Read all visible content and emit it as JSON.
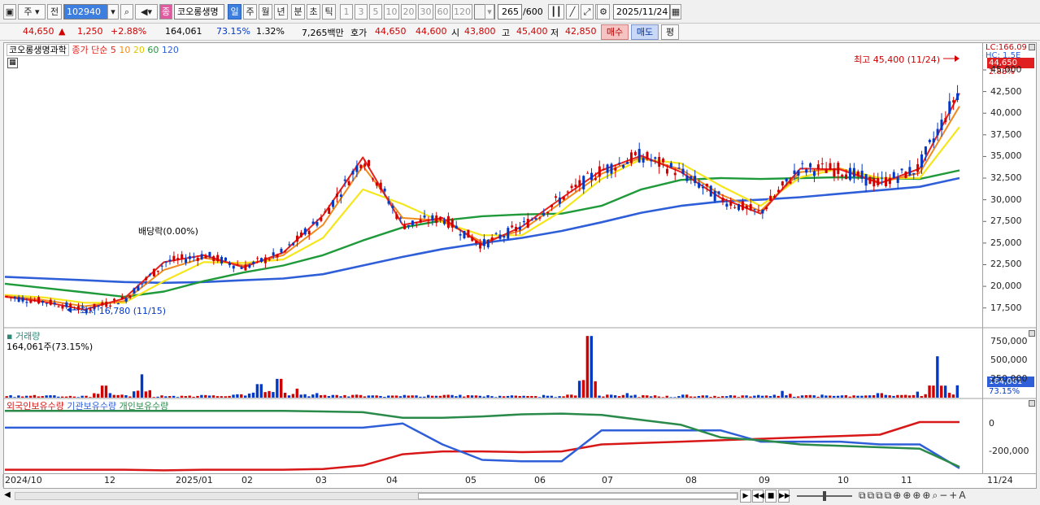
{
  "toolbar": {
    "market": "주",
    "market2": "전",
    "code": "102940",
    "stock_name": "코오롱생명",
    "badge": "종",
    "periods": [
      "일",
      "주",
      "월",
      "년",
      "분",
      "초",
      "틱"
    ],
    "period_selected": "일",
    "intervals": [
      "1",
      "3",
      "5",
      "10",
      "20",
      "30",
      "60",
      "120"
    ],
    "count": "265",
    "count_total": "/600",
    "date": "2025/11/24"
  },
  "quote": {
    "price": "44,650",
    "arrow": "▲",
    "change": "1,250",
    "change_pct": "+2.88%",
    "volume": "164,061",
    "vol_ratio": "73.15%",
    "turnover": "1.32%",
    "amount": "7,265백만",
    "ask_label": "호가",
    "ask": "44,650",
    "bid": "44,600",
    "open_label": "시",
    "open": "43,800",
    "high_label": "고",
    "high": "45,400",
    "low_label": "저",
    "low": "42,850",
    "buy": "매수",
    "sell": "매도",
    "avg": "평"
  },
  "price_panel": {
    "title": "코오롱생명과학",
    "ma_label": "종가 단순",
    "ma_periods": [
      "5",
      "10",
      "20",
      "60",
      "120"
    ],
    "high_note": "최고 45,400 (11/24)",
    "low_note": "최저 16,780 (11/15)",
    "dividend_note": "배당락(0.00%)",
    "right_top1": "LC:166.09",
    "right_top2": "HC: 1.5E",
    "current_tag": "44,650",
    "current_pct": "2.88%"
  },
  "volume_panel": {
    "title": "거래량",
    "value": "164,061주(73.15%)",
    "tag": "164,061",
    "tag_pct": "73.15%"
  },
  "holding_panel": {
    "legends": [
      "외국인보유수량",
      "기관보유수량",
      "개인보유수량"
    ]
  },
  "colors": {
    "up": "#d00000",
    "down": "#0038c8",
    "ma5": "#e8221c",
    "ma10": "#f08a1c",
    "ma20": "#f5e61c",
    "ma60": "#1f9a3a",
    "ma120": "#2f5fd8",
    "foreign": "#d81818",
    "inst": "#2f5fd8",
    "retail": "#2a8a4a"
  },
  "chart_data": [
    {
      "type": "line",
      "title": "코오롱생명과학",
      "x": [
        "2024/10",
        "12",
        "2025/01",
        "02",
        "03",
        "04",
        "05",
        "06",
        "07",
        "08",
        "09",
        "10",
        "11",
        "11/24"
      ],
      "y_ticks": [
        "45,000",
        "42,500",
        "40,000",
        "37,500",
        "35,000",
        "32,500",
        "30,000",
        "27,500",
        "25,000",
        "22,500",
        "20,000",
        "17,500"
      ],
      "ylim": [
        15500,
        46500
      ],
      "series": [
        {
          "name": "5",
          "values": [
            18800,
            18200,
            17300,
            18600,
            22800,
            23600,
            22200,
            23900,
            28200,
            34900,
            27100,
            27900,
            24800,
            26900,
            30200,
            33400,
            35100,
            33200,
            30200,
            28400,
            33600,
            33500,
            31900,
            33600,
            42300
          ]
        },
        {
          "name": "10",
          "values": [
            18900,
            18400,
            17700,
            18300,
            21900,
            23300,
            22400,
            23600,
            27100,
            33900,
            27900,
            27600,
            25100,
            26500,
            29700,
            33000,
            34900,
            33500,
            30600,
            28700,
            33200,
            33600,
            32000,
            33100,
            40800
          ]
        },
        {
          "name": "20",
          "values": [
            19000,
            18700,
            18100,
            18100,
            20600,
            22800,
            22700,
            23100,
            25600,
            31200,
            29500,
            27400,
            25900,
            25900,
            28700,
            32400,
            34700,
            34200,
            31600,
            29300,
            32600,
            33600,
            32500,
            32500,
            38400
          ]
        },
        {
          "name": "60",
          "values": [
            20300,
            19800,
            19300,
            18800,
            19400,
            20600,
            21600,
            22400,
            23600,
            25300,
            26800,
            27600,
            28100,
            28300,
            28400,
            29300,
            31200,
            32300,
            32500,
            32400,
            32500,
            32600,
            32500,
            32400,
            33400
          ]
        },
        {
          "name": "120",
          "values": [
            21100,
            20900,
            20700,
            20500,
            20400,
            20500,
            20700,
            20900,
            21400,
            22400,
            23400,
            24300,
            25000,
            25600,
            26400,
            27400,
            28500,
            29300,
            29800,
            30000,
            30300,
            30700,
            31100,
            31500,
            32500
          ]
        }
      ]
    },
    {
      "type": "bar",
      "title": "거래량",
      "y_ticks": [
        "750,000",
        "500,000",
        "250,000"
      ],
      "ylim": [
        0,
        800000
      ],
      "values": [
        20000,
        25000,
        30000,
        15000,
        25000,
        160000,
        40000,
        310000,
        30000,
        25000,
        35000,
        20000,
        45000,
        180000,
        250000,
        120000,
        60000,
        35000,
        40000,
        30000,
        28000,
        30000,
        25000,
        35000,
        30000,
        20000,
        30000,
        22000,
        25000,
        40000,
        820000,
        40000,
        60000,
        30000,
        25000,
        40000,
        30000,
        20000,
        30000,
        25000,
        90000,
        30000,
        40000,
        30000,
        25000,
        60000,
        35000,
        80000,
        550000,
        164061
      ]
    },
    {
      "type": "line",
      "title": "보유수량",
      "y_ticks": [
        "0",
        "-200,000"
      ],
      "series": [
        {
          "name": "외국인보유수량",
          "values": [
            -330000,
            -330000,
            -330000,
            -330000,
            -335000,
            -330000,
            -330000,
            -330000,
            -325000,
            -300000,
            -220000,
            -200000,
            -200000,
            -205000,
            -200000,
            -150000,
            -140000,
            -130000,
            -120000,
            -110000,
            -100000,
            -90000,
            -80000,
            10000,
            10000
          ]
        },
        {
          "name": "기관보유수량",
          "values": [
            -30000,
            -30000,
            -30000,
            -30000,
            -30000,
            -30000,
            -30000,
            -30000,
            -30000,
            -30000,
            0,
            -150000,
            -260000,
            -270000,
            -270000,
            -50000,
            -50000,
            -50000,
            -50000,
            -130000,
            -130000,
            -130000,
            -150000,
            -150000,
            -320000
          ]
        },
        {
          "name": "개인보유수량",
          "values": [
            90000,
            90000,
            90000,
            90000,
            90000,
            90000,
            90000,
            90000,
            85000,
            80000,
            40000,
            40000,
            50000,
            65000,
            70000,
            60000,
            25000,
            -10000,
            -100000,
            -120000,
            -150000,
            -160000,
            -170000,
            -180000,
            -310000
          ]
        }
      ]
    }
  ]
}
